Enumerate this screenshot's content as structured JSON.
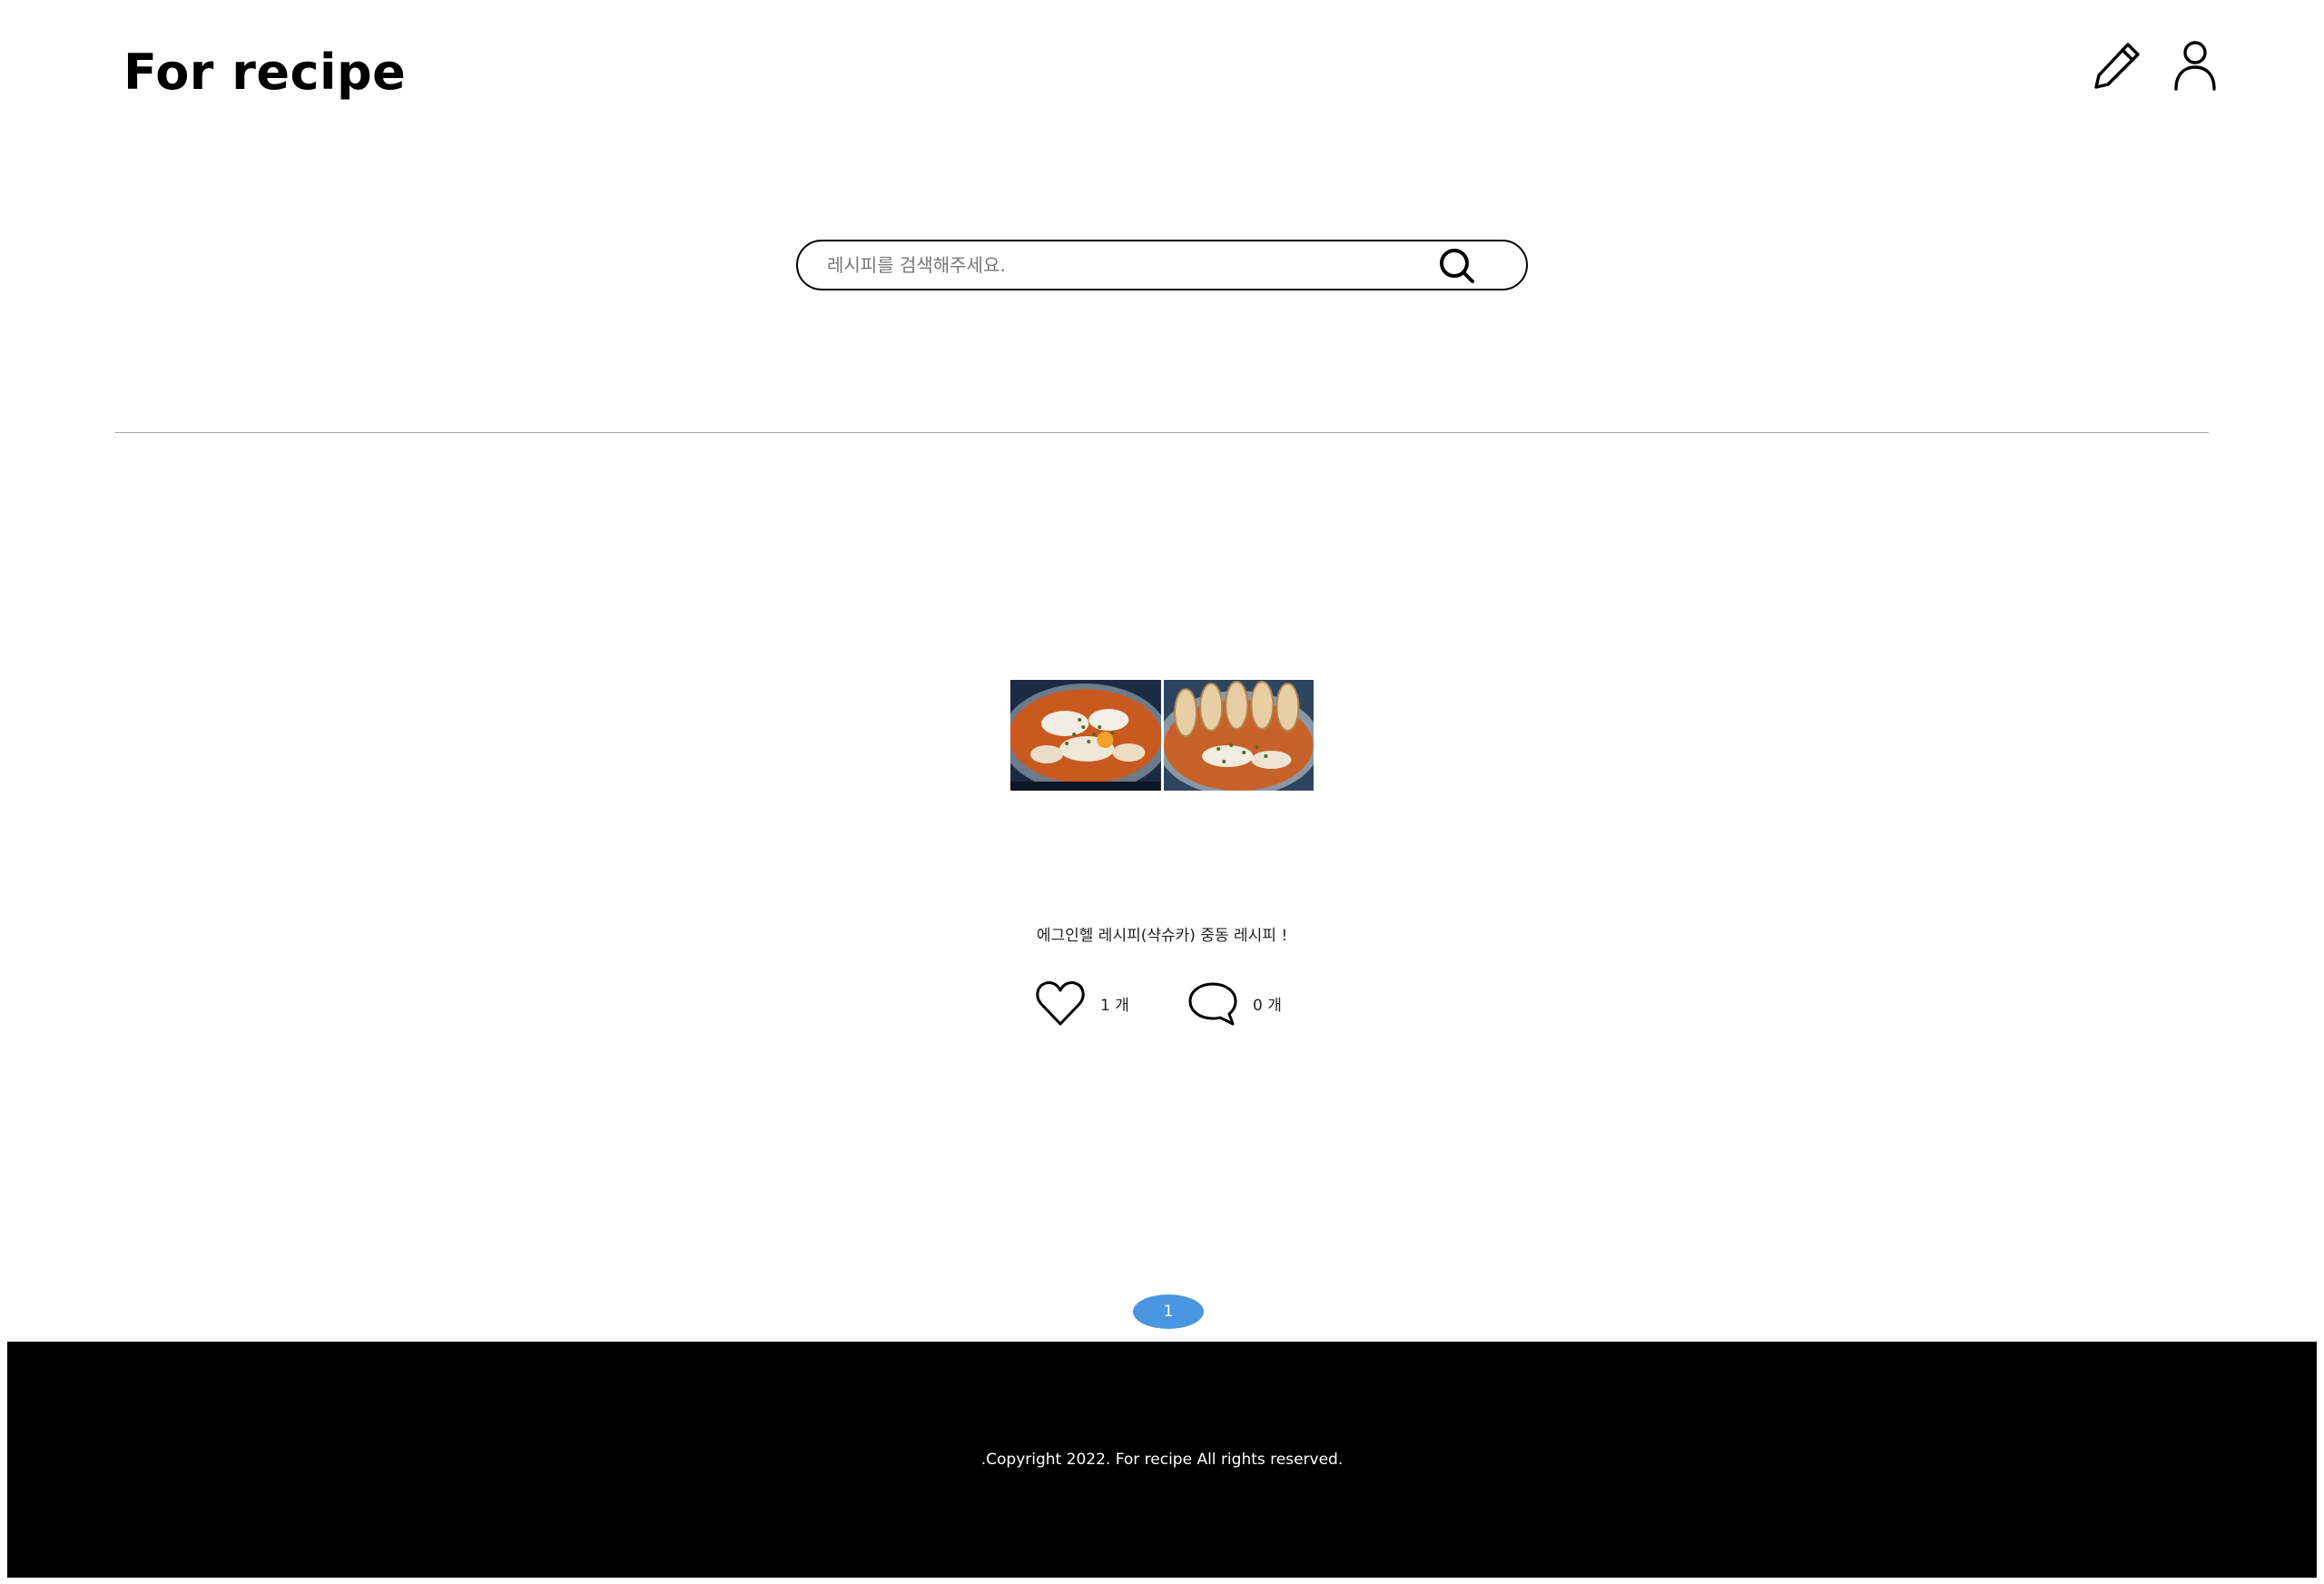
{
  "header": {
    "logo_text": "For recipe",
    "icons": [
      "pencil-icon",
      "user-icon"
    ]
  },
  "search": {
    "placeholder": "레시피를 검색해주세요.",
    "value": "",
    "icon": "search-icon"
  },
  "recipes": [
    {
      "title": "에그인헬 레시피(샥슈카) 중동 레시피 !",
      "images": [
        "egg-in-hell-photo",
        "egg-in-hell-with-baguette-photo"
      ],
      "likes": {
        "icon": "heart-icon",
        "label": "1 개"
      },
      "comments": {
        "icon": "comment-bubble-icon",
        "label": "0 개"
      }
    }
  ],
  "pagination": {
    "pages": [
      "1"
    ],
    "current": "1",
    "active_color": "#4a96e0"
  },
  "footer": {
    "copyright": ".Copyright 2022. For recipe All rights reserved.",
    "background": "#000000"
  }
}
